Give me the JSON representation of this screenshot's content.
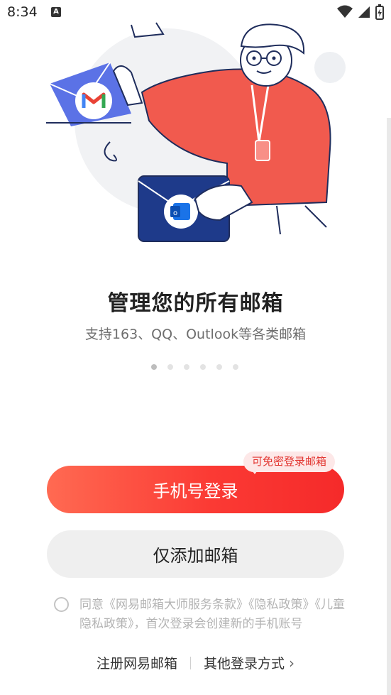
{
  "status_bar": {
    "time": "8:34",
    "notif_letter": "A"
  },
  "onboarding": {
    "title": "管理您的所有邮箱",
    "subtitle": "支持163、QQ、Outlook等各类邮箱",
    "pages": 6,
    "active_page": 1
  },
  "badge": {
    "text": "可免密登录邮箱"
  },
  "buttons": {
    "phone_login": "手机号登录",
    "add_mailbox": "仅添加邮箱"
  },
  "agreement": {
    "prefix": "同意",
    "terms": "《网易邮箱大师服务条款》",
    "privacy": "《隐私政策》",
    "child_privacy": "《儿童隐私政策》",
    "suffix": "，首次登录会创建新的手机账号"
  },
  "links": {
    "register": "注册网易邮箱",
    "other_login": "其他登录方式"
  },
  "colors": {
    "primary": "#fb3a34",
    "badge_bg": "#fde8e8",
    "badge_text": "#e2342f",
    "gmail_card": "#5b72e6",
    "outlook_card": "#1e3a8a"
  }
}
